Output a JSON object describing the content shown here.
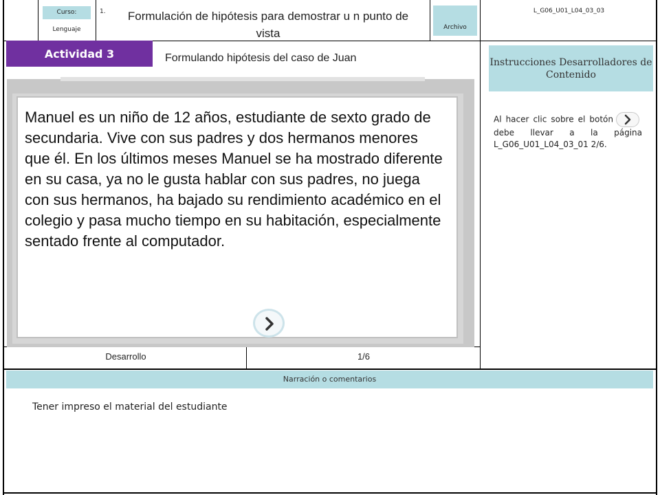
{
  "header": {
    "course_label": "Curso:",
    "subject": "Lenguaje",
    "number": "1.",
    "title": "Formulación de hipótesis para demostrar u n punto de vista",
    "file_label": "Archivo",
    "code": "L_G06_U01_L04_03_03"
  },
  "activity": {
    "tag": "Actividad 3",
    "subtitle": "Formulando hipótesis del caso de Juan"
  },
  "content": {
    "story": "Manuel es un niño de 12 años, estudiante de sexto grado de secundaria. Vive con sus padres y dos hermanos menores que él. En los últimos meses Manuel se ha mostrado diferente en su casa, ya no le gusta hablar con sus padres, no juega con sus hermanos, ha bajado su rendimiento académico en el colegio y pasa mucho tiempo en su habitación, especialmente sentado frente al computador.",
    "next_icon": "chevron-right-icon"
  },
  "instructions": {
    "heading": "Instrucciones Desarrolladores de Contenido",
    "text_before": "Al hacer clic sobre el botón",
    "text_after": "debe llevar a la página L_G06_U01_L04_03_01 2/6."
  },
  "footer": {
    "section": "Desarrollo",
    "page": "1/6"
  },
  "narration": {
    "heading": "Narración o comentarios",
    "text": "Tener impreso el material del estudiante"
  },
  "colors": {
    "accent_purple": "#7030a0",
    "label_blue": "#b5dde3"
  }
}
